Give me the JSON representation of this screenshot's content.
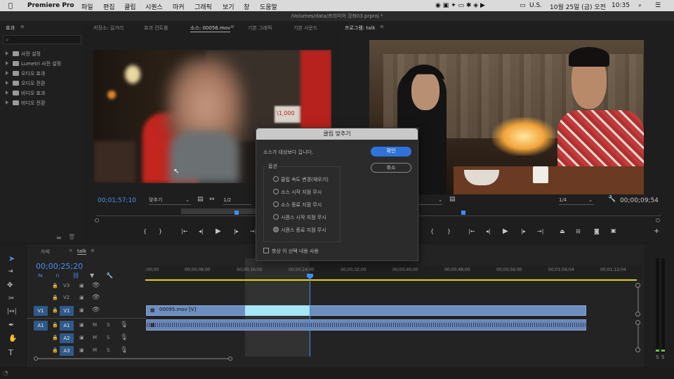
{
  "menubar": {
    "app_name": "Premiere Pro",
    "items": [
      "파일",
      "편집",
      "클립",
      "시퀀스",
      "마커",
      "그래픽",
      "보기",
      "창",
      "도움말"
    ],
    "input_source": "U.S.",
    "datetime": "10월 25일 (금) 오전",
    "time": "10:35"
  },
  "title": "/Volumes/data/프리미어 강좌03.prproj *",
  "effects_panel": {
    "tab": "효과",
    "items": [
      "사전 설정",
      "Lumetri 사전 설정",
      "오디오 효과",
      "오디오 전환",
      "비디오 효과",
      "비디오 전환"
    ]
  },
  "source_panel": {
    "tabs": [
      "저장소: 길거리",
      "효과 컨트롤",
      "소스: 00056.mov",
      "기본 그래픽",
      "기본 사운드"
    ],
    "timecode": "00;01;57;10",
    "fit": "맞추기",
    "resolution": "1/2",
    "sign_text": "\\1,000"
  },
  "program_panel": {
    "tab": "프로그램: talk",
    "timecode": "00;00;09;54",
    "resolution": "1/4"
  },
  "dialog": {
    "title": "클립 맞추기",
    "message": "소스가 대상보다 깁니다.",
    "ok": "확인",
    "cancel": "취소",
    "options_label": "옵션",
    "options": [
      "클립 속도 변경(채우기)",
      "소스 시작 지점 무시",
      "소스 종료 지점 무시",
      "시퀀스 시작 지점 무시",
      "시퀀스 종료 지점 무시"
    ],
    "selected_option": 4,
    "always_use": "항상 이 선택 내용 사용"
  },
  "timeline": {
    "tabs": [
      "카페",
      "talk"
    ],
    "timecode": "00;00;25;20",
    "ruler": [
      ";00;00",
      "00;00;08;00",
      "00;00;16;00",
      "00;00;24;00",
      "00;00;32;00",
      "00;00;40;00",
      "00;00;48;00",
      "00;00;56;00",
      "00;01;04;04",
      "00;01;12;04"
    ],
    "video_tracks": [
      "V3",
      "V2",
      "V1"
    ],
    "audio_tracks": [
      "A1",
      "A2",
      "A3"
    ],
    "source_patch_v": "V1",
    "source_patch_a": "A1",
    "clip_label": "00095.mov [V]",
    "solo_labels": [
      "S",
      "S"
    ]
  },
  "colors": {
    "accent_blue": "#4b8ef0",
    "clip_video": "#6c8fbf",
    "clip_insert": "#a7e6f6",
    "clip_audio": "#6a86b8",
    "playhead": "#3f8ef2",
    "work_area": "#e5d300"
  }
}
